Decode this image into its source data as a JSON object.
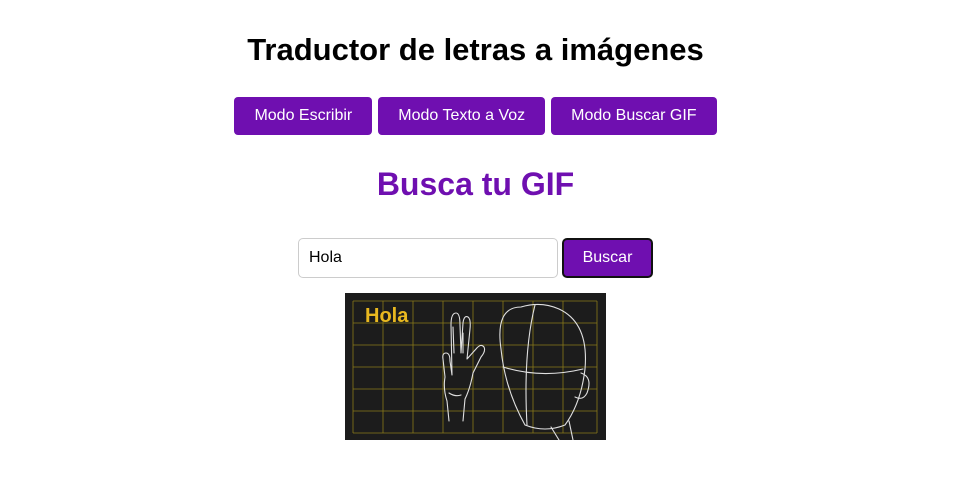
{
  "header": {
    "title": "Traductor de letras a imágenes"
  },
  "modes": [
    {
      "label": "Modo Escribir"
    },
    {
      "label": "Modo Texto a Voz"
    },
    {
      "label": "Modo Buscar GIF"
    }
  ],
  "gif_search": {
    "title": "Busca tu GIF",
    "input_value": "Hola",
    "button_label": "Buscar"
  },
  "gif_result": {
    "caption": "Hola"
  },
  "colors": {
    "accent": "#6f0fb0",
    "gif_background": "#1c1c1c",
    "gif_grid": "#8a7a1a",
    "gif_caption": "#e8b820"
  }
}
